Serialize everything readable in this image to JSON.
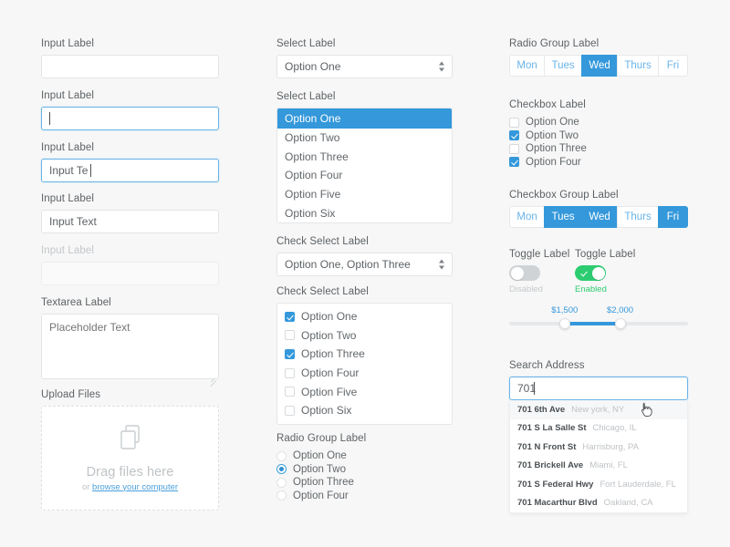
{
  "colors": {
    "accent": "#3498db",
    "green": "#2ecc71",
    "bg": "#f7f7f7",
    "text": "#5d6266",
    "muted": "#c3c7ca"
  },
  "column1": {
    "input_empty": {
      "label": "Input Label",
      "value": "",
      "placeholder": ""
    },
    "input_focused_empty": {
      "label": "Input Label",
      "value": "",
      "placeholder": ""
    },
    "input_focused_typing": {
      "label": "Input Label",
      "value": "Input Te",
      "placeholder": ""
    },
    "input_filled": {
      "label": "Input Label",
      "value": "Input Text",
      "placeholder": ""
    },
    "input_disabled": {
      "label": "Input Label",
      "value": "",
      "placeholder": ""
    },
    "textarea": {
      "label": "Textarea Label",
      "value": "",
      "placeholder": "Placeholder Text"
    },
    "upload": {
      "label": "Upload Files",
      "icon": "files-icon",
      "title": "Drag files here",
      "sub_prefix": "or ",
      "sub_link": "browse your computer"
    }
  },
  "column2": {
    "select_collapsed": {
      "label": "Select Label",
      "value": "Option One"
    },
    "select_open": {
      "label": "Select Label",
      "selected": "Option One",
      "options": [
        "Option One",
        "Option Two",
        "Option Three",
        "Option Four",
        "Option Five",
        "Option Six"
      ]
    },
    "check_select_collapsed": {
      "label": "Check Select Label",
      "value": "Option One, Option Three"
    },
    "check_select_open": {
      "label": "Check Select Label",
      "options": [
        {
          "label": "Option One",
          "checked": true
        },
        {
          "label": "Option Two",
          "checked": false
        },
        {
          "label": "Option Three",
          "checked": true
        },
        {
          "label": "Option Four",
          "checked": false
        },
        {
          "label": "Option Five",
          "checked": false
        },
        {
          "label": "Option Six",
          "checked": false
        }
      ]
    },
    "radio_group": {
      "label": "Radio Group Label",
      "options": [
        {
          "label": "Option One",
          "selected": false
        },
        {
          "label": "Option Two",
          "selected": true
        },
        {
          "label": "Option Three",
          "selected": false
        },
        {
          "label": "Option Four",
          "selected": false
        }
      ]
    }
  },
  "column3": {
    "radio_buttons": {
      "label": "Radio Group Label",
      "options": [
        {
          "label": "Mon",
          "active": false
        },
        {
          "label": "Tues",
          "active": false
        },
        {
          "label": "Wed",
          "active": true
        },
        {
          "label": "Thurs",
          "active": false
        },
        {
          "label": "Fri",
          "active": false
        }
      ]
    },
    "checkbox_list": {
      "label": "Checkbox Label",
      "options": [
        {
          "label": "Option One",
          "checked": false
        },
        {
          "label": "Option Two",
          "checked": true
        },
        {
          "label": "Option Three",
          "checked": false
        },
        {
          "label": "Option Four",
          "checked": true
        }
      ]
    },
    "checkbox_buttons": {
      "label": "Checkbox Group Label",
      "options": [
        {
          "label": "Mon",
          "active": false
        },
        {
          "label": "Tues",
          "active": true
        },
        {
          "label": "Wed",
          "active": true
        },
        {
          "label": "Thurs",
          "active": false
        },
        {
          "label": "Fri",
          "active": true
        }
      ]
    },
    "toggles": [
      {
        "label": "Toggle Label",
        "state_text": "Disabled",
        "on": false
      },
      {
        "label": "Toggle Label",
        "state_text": "Enabled",
        "on": true
      }
    ],
    "slider": {
      "min_label": "$1,500",
      "max_label": "$2,000",
      "min_pct": 31,
      "max_pct": 62
    },
    "search": {
      "label": "Search Address",
      "value": "701",
      "placeholder": "",
      "suggestions": [
        {
          "street": "701 6th Ave",
          "city": "New york, NY",
          "highlighted": true
        },
        {
          "street": "701 S La Salle St",
          "city": "Chicago, IL",
          "highlighted": false
        },
        {
          "street": "701 N Front St",
          "city": "Harrisburg, PA",
          "highlighted": false
        },
        {
          "street": "701 Brickell Ave",
          "city": "Miami, FL",
          "highlighted": false
        },
        {
          "street": "701 S Federal Hwy",
          "city": "Fort Lauderdale, FL",
          "highlighted": false
        },
        {
          "street": "701 Macarthur Blvd",
          "city": "Oakland, CA",
          "highlighted": false
        }
      ],
      "cursor": "pointer-hand-cursor"
    }
  }
}
